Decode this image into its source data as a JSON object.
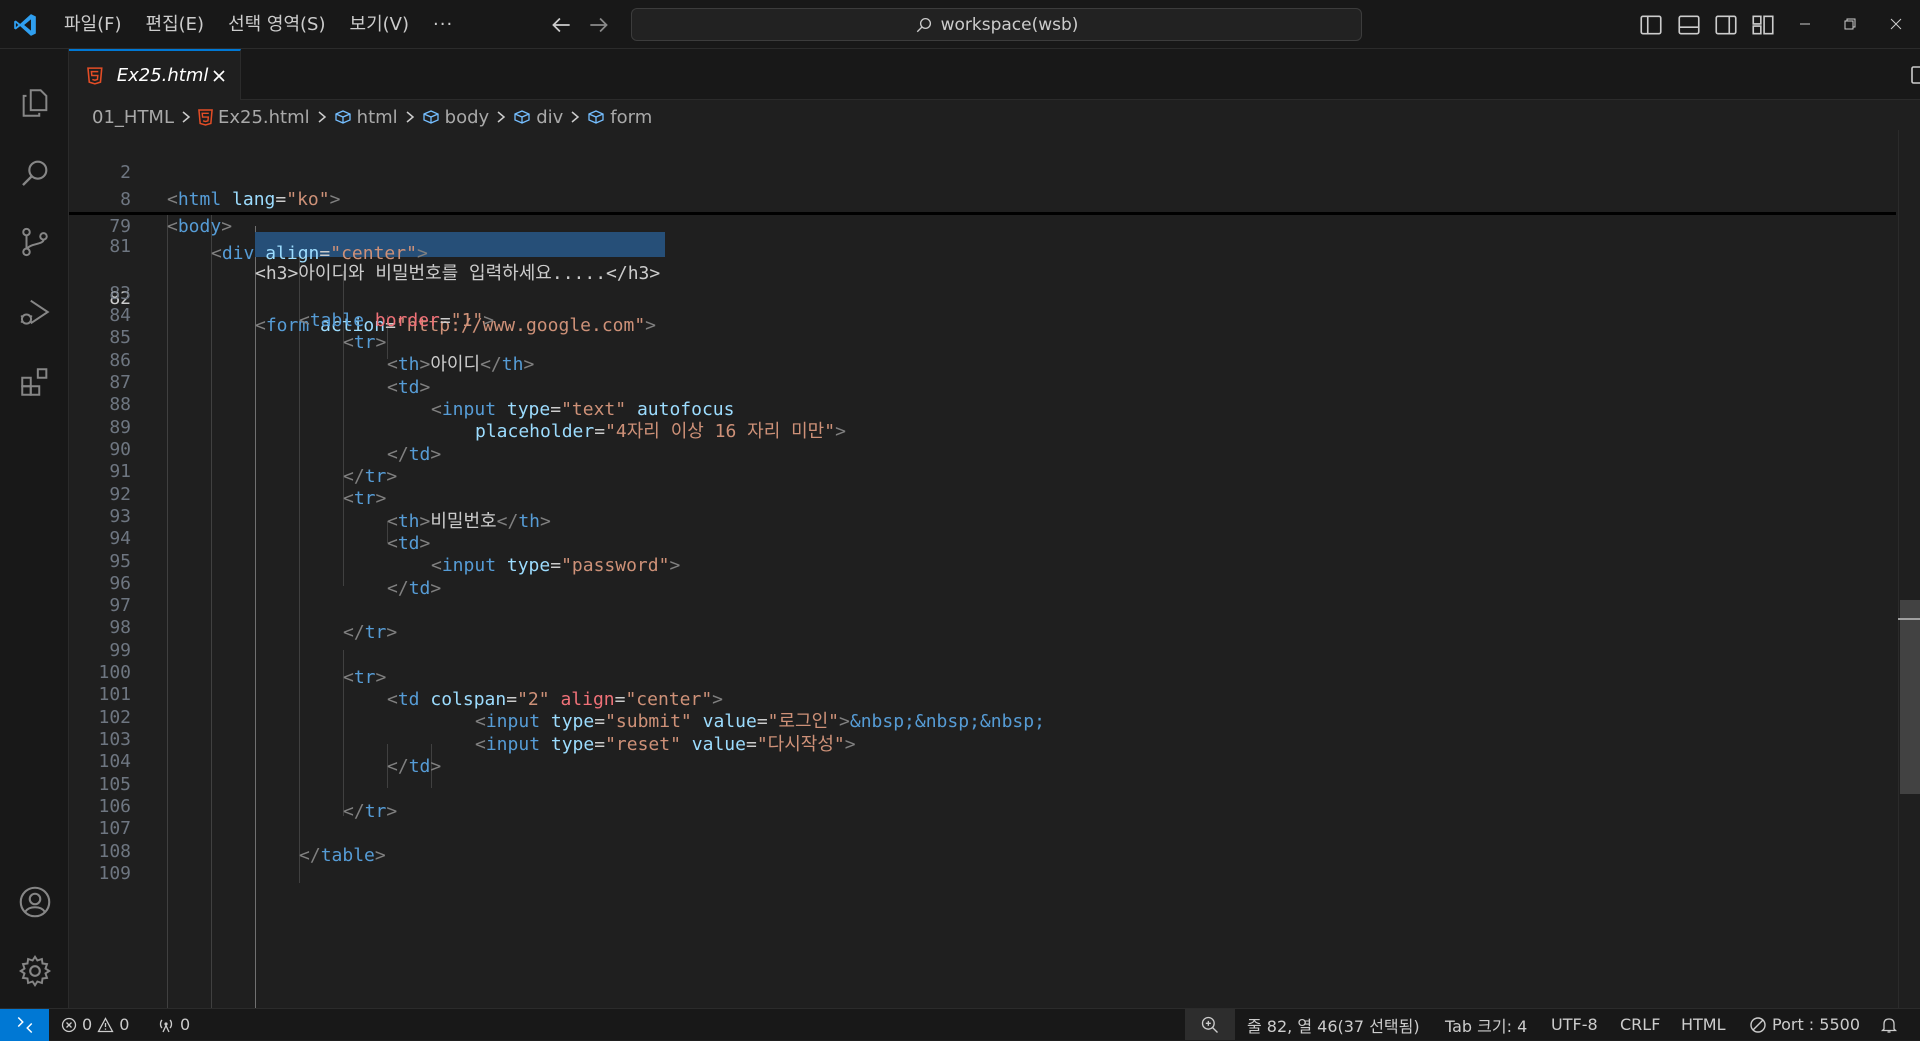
{
  "menu": {
    "items": [
      "파일(F)",
      "편집(E)",
      "선택 영역(S)",
      "보기(V)"
    ],
    "more": "···"
  },
  "search": {
    "label": "workspace(wsb)"
  },
  "tab": {
    "label": "Ex25.html",
    "close": "×"
  },
  "breadcrumb": {
    "items": [
      "01_HTML",
      "Ex25.html",
      "html",
      "body",
      "div",
      "form"
    ]
  },
  "editor": {
    "sticky_lines": [
      {
        "ln": "2"
      },
      {
        "ln": "8"
      },
      {
        "ln": "79"
      }
    ],
    "lines": [
      {
        "ln": "81"
      },
      {
        "ln": "82"
      },
      {
        "ln": "83"
      },
      {
        "ln": "84"
      },
      {
        "ln": "85"
      },
      {
        "ln": "86"
      },
      {
        "ln": "87"
      },
      {
        "ln": "88"
      },
      {
        "ln": "89"
      },
      {
        "ln": "90"
      },
      {
        "ln": "91"
      },
      {
        "ln": "92"
      },
      {
        "ln": "93"
      },
      {
        "ln": "94"
      },
      {
        "ln": "95"
      },
      {
        "ln": "96"
      },
      {
        "ln": "97"
      },
      {
        "ln": "98"
      },
      {
        "ln": "99"
      },
      {
        "ln": "100"
      },
      {
        "ln": "101"
      },
      {
        "ln": "102"
      },
      {
        "ln": "103"
      },
      {
        "ln": "104"
      },
      {
        "ln": "105"
      },
      {
        "ln": "106"
      },
      {
        "ln": "107"
      },
      {
        "ln": "108"
      },
      {
        "ln": "109"
      }
    ],
    "code": {
      "sticky_html": [
        "<",
        "html",
        "lang",
        "=",
        "\"ko\"",
        ">"
      ],
      "sticky_body": [
        "<",
        "body",
        ">"
      ],
      "sticky_div": [
        "<",
        "div",
        "align",
        "=",
        "\"center\"",
        ">"
      ],
      "l81": "<h3>아이디와 비밀번호를 입력하세요.....</h3>",
      "l82_tag": "form",
      "l82_attr": "action",
      "l82_val": "\"http://www.google.com\"",
      "l83_tag": "table",
      "l83_attr": "border",
      "l83_val": "\"1\"",
      "tr": "tr",
      "th": "th",
      "td": "td",
      "input": "input",
      "table": "table",
      "form": "form",
      "id_label": "아이디",
      "type": "type",
      "text_val": "\"text\"",
      "autofocus": "autofocus",
      "placeholder": "placeholder",
      "placeholder_val": "\"4자리 이상 16 자리 미만\"",
      "pw_label": "비밀번호",
      "password_val": "\"password\"",
      "colspan": "colspan",
      "colspan_val": "\"2\"",
      "align": "align",
      "center_val": "\"center\"",
      "submit_val": "\"submit\"",
      "value": "value",
      "login_val": "\"로그인\"",
      "nbsp": "&nbsp;&nbsp;&nbsp;",
      "reset_val": "\"reset\"",
      "rewrite_val": "\"다시작성\""
    }
  },
  "statusbar": {
    "errors": "0",
    "warnings": "0",
    "ports": "0",
    "cursor": "줄 82, 열 46(37 선택됨)",
    "tab_size": "Tab 크기: 4",
    "encoding": "UTF-8",
    "eol": "CRLF",
    "language": "HTML",
    "port": "Port : 5500"
  },
  "colors": {
    "accent": "#0078d4",
    "tag": "#569cd6",
    "attribute": "#9cdcfe",
    "string": "#ce9178",
    "selection": "#264f78",
    "html_icon": "#e44d26"
  }
}
